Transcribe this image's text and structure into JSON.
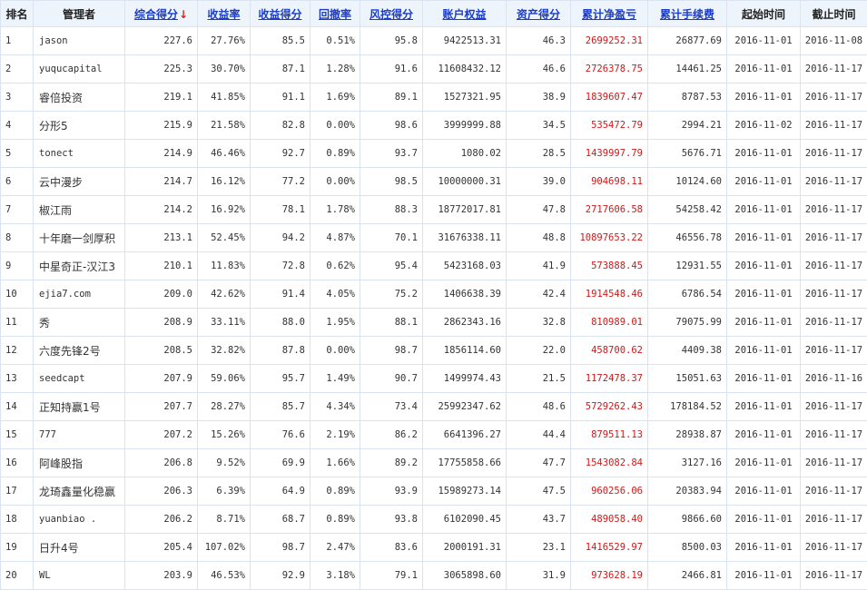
{
  "columns": {
    "rank": "排名",
    "manager": "管理者",
    "composite_score": "综合得分",
    "sort_arrow": "↓",
    "return_rate": "收益率",
    "return_score": "收益得分",
    "drawdown": "回撤率",
    "risk_score": "风控得分",
    "equity": "账户权益",
    "asset_score": "资产得分",
    "net_pnl": "累计净盈亏",
    "fees": "累计手续费",
    "start_date": "起始时间",
    "end_date": "截止时间"
  },
  "colors": {
    "link": "#1a3cc8",
    "sort_arrow": "#e02020",
    "net_pnl": "#d01818",
    "header_bg": "#eef4fb",
    "border": "#d9e4f0"
  },
  "rows": [
    {
      "rank": "1",
      "manager": "jason",
      "composite": "227.6",
      "return_rate": "27.76%",
      "return_score": "85.5",
      "drawdown": "0.51%",
      "risk_score": "95.8",
      "equity": "9422513.31",
      "asset_score": "46.3",
      "net_pnl": "2699252.31",
      "fees": "26877.69",
      "start": "2016-11-01",
      "end": "2016-11-08"
    },
    {
      "rank": "2",
      "manager": "yuqucapital",
      "composite": "225.3",
      "return_rate": "30.70%",
      "return_score": "87.1",
      "drawdown": "1.28%",
      "risk_score": "91.6",
      "equity": "11608432.12",
      "asset_score": "46.6",
      "net_pnl": "2726378.75",
      "fees": "14461.25",
      "start": "2016-11-01",
      "end": "2016-11-17"
    },
    {
      "rank": "3",
      "manager": "睿倍投资",
      "composite": "219.1",
      "return_rate": "41.85%",
      "return_score": "91.1",
      "drawdown": "1.69%",
      "risk_score": "89.1",
      "equity": "1527321.95",
      "asset_score": "38.9",
      "net_pnl": "1839607.47",
      "fees": "8787.53",
      "start": "2016-11-01",
      "end": "2016-11-17"
    },
    {
      "rank": "4",
      "manager": "分形5",
      "composite": "215.9",
      "return_rate": "21.58%",
      "return_score": "82.8",
      "drawdown": "0.00%",
      "risk_score": "98.6",
      "equity": "3999999.88",
      "asset_score": "34.5",
      "net_pnl": "535472.79",
      "fees": "2994.21",
      "start": "2016-11-02",
      "end": "2016-11-17"
    },
    {
      "rank": "5",
      "manager": "tonect",
      "composite": "214.9",
      "return_rate": "46.46%",
      "return_score": "92.7",
      "drawdown": "0.89%",
      "risk_score": "93.7",
      "equity": "1080.02",
      "asset_score": "28.5",
      "net_pnl": "1439997.79",
      "fees": "5676.71",
      "start": "2016-11-01",
      "end": "2016-11-17"
    },
    {
      "rank": "6",
      "manager": "云中漫步",
      "composite": "214.7",
      "return_rate": "16.12%",
      "return_score": "77.2",
      "drawdown": "0.00%",
      "risk_score": "98.5",
      "equity": "10000000.31",
      "asset_score": "39.0",
      "net_pnl": "904698.11",
      "fees": "10124.60",
      "start": "2016-11-01",
      "end": "2016-11-17"
    },
    {
      "rank": "7",
      "manager": "椒江雨",
      "composite": "214.2",
      "return_rate": "16.92%",
      "return_score": "78.1",
      "drawdown": "1.78%",
      "risk_score": "88.3",
      "equity": "18772017.81",
      "asset_score": "47.8",
      "net_pnl": "2717606.58",
      "fees": "54258.42",
      "start": "2016-11-01",
      "end": "2016-11-17"
    },
    {
      "rank": "8",
      "manager": "十年磨一剑厚积",
      "composite": "213.1",
      "return_rate": "52.45%",
      "return_score": "94.2",
      "drawdown": "4.87%",
      "risk_score": "70.1",
      "equity": "31676338.11",
      "asset_score": "48.8",
      "net_pnl": "10897653.22",
      "fees": "46556.78",
      "start": "2016-11-01",
      "end": "2016-11-17"
    },
    {
      "rank": "9",
      "manager": "中星奇正-汉江3",
      "composite": "210.1",
      "return_rate": "11.83%",
      "return_score": "72.8",
      "drawdown": "0.62%",
      "risk_score": "95.4",
      "equity": "5423168.03",
      "asset_score": "41.9",
      "net_pnl": "573888.45",
      "fees": "12931.55",
      "start": "2016-11-01",
      "end": "2016-11-17"
    },
    {
      "rank": "10",
      "manager": "ejia7.com",
      "composite": "209.0",
      "return_rate": "42.62%",
      "return_score": "91.4",
      "drawdown": "4.05%",
      "risk_score": "75.2",
      "equity": "1406638.39",
      "asset_score": "42.4",
      "net_pnl": "1914548.46",
      "fees": "6786.54",
      "start": "2016-11-01",
      "end": "2016-11-17"
    },
    {
      "rank": "11",
      "manager": "秀",
      "composite": "208.9",
      "return_rate": "33.11%",
      "return_score": "88.0",
      "drawdown": "1.95%",
      "risk_score": "88.1",
      "equity": "2862343.16",
      "asset_score": "32.8",
      "net_pnl": "810989.01",
      "fees": "79075.99",
      "start": "2016-11-01",
      "end": "2016-11-17"
    },
    {
      "rank": "12",
      "manager": "六度先锋2号",
      "composite": "208.5",
      "return_rate": "32.82%",
      "return_score": "87.8",
      "drawdown": "0.00%",
      "risk_score": "98.7",
      "equity": "1856114.60",
      "asset_score": "22.0",
      "net_pnl": "458700.62",
      "fees": "4409.38",
      "start": "2016-11-01",
      "end": "2016-11-17"
    },
    {
      "rank": "13",
      "manager": "seedcapt",
      "composite": "207.9",
      "return_rate": "59.06%",
      "return_score": "95.7",
      "drawdown": "1.49%",
      "risk_score": "90.7",
      "equity": "1499974.43",
      "asset_score": "21.5",
      "net_pnl": "1172478.37",
      "fees": "15051.63",
      "start": "2016-11-01",
      "end": "2016-11-16"
    },
    {
      "rank": "14",
      "manager": "正知持赢1号",
      "composite": "207.7",
      "return_rate": "28.27%",
      "return_score": "85.7",
      "drawdown": "4.34%",
      "risk_score": "73.4",
      "equity": "25992347.62",
      "asset_score": "48.6",
      "net_pnl": "5729262.43",
      "fees": "178184.52",
      "start": "2016-11-01",
      "end": "2016-11-17"
    },
    {
      "rank": "15",
      "manager": "777",
      "composite": "207.2",
      "return_rate": "15.26%",
      "return_score": "76.6",
      "drawdown": "2.19%",
      "risk_score": "86.2",
      "equity": "6641396.27",
      "asset_score": "44.4",
      "net_pnl": "879511.13",
      "fees": "28938.87",
      "start": "2016-11-01",
      "end": "2016-11-17"
    },
    {
      "rank": "16",
      "manager": "阿峰股指",
      "composite": "206.8",
      "return_rate": "9.52%",
      "return_score": "69.9",
      "drawdown": "1.66%",
      "risk_score": "89.2",
      "equity": "17755858.66",
      "asset_score": "47.7",
      "net_pnl": "1543082.84",
      "fees": "3127.16",
      "start": "2016-11-01",
      "end": "2016-11-17"
    },
    {
      "rank": "17",
      "manager": "龙琦鑫量化稳赢",
      "composite": "206.3",
      "return_rate": "6.39%",
      "return_score": "64.9",
      "drawdown": "0.89%",
      "risk_score": "93.9",
      "equity": "15989273.14",
      "asset_score": "47.5",
      "net_pnl": "960256.06",
      "fees": "20383.94",
      "start": "2016-11-01",
      "end": "2016-11-17"
    },
    {
      "rank": "18",
      "manager": "yuanbiao .",
      "composite": "206.2",
      "return_rate": "8.71%",
      "return_score": "68.7",
      "drawdown": "0.89%",
      "risk_score": "93.8",
      "equity": "6102090.45",
      "asset_score": "43.7",
      "net_pnl": "489058.40",
      "fees": "9866.60",
      "start": "2016-11-01",
      "end": "2016-11-17"
    },
    {
      "rank": "19",
      "manager": "日升4号",
      "composite": "205.4",
      "return_rate": "107.02%",
      "return_score": "98.7",
      "drawdown": "2.47%",
      "risk_score": "83.6",
      "equity": "2000191.31",
      "asset_score": "23.1",
      "net_pnl": "1416529.97",
      "fees": "8500.03",
      "start": "2016-11-01",
      "end": "2016-11-17"
    },
    {
      "rank": "20",
      "manager": "WL",
      "composite": "203.9",
      "return_rate": "46.53%",
      "return_score": "92.9",
      "drawdown": "3.18%",
      "risk_score": "79.1",
      "equity": "3065898.60",
      "asset_score": "31.9",
      "net_pnl": "973628.19",
      "fees": "2466.81",
      "start": "2016-11-01",
      "end": "2016-11-17"
    }
  ]
}
